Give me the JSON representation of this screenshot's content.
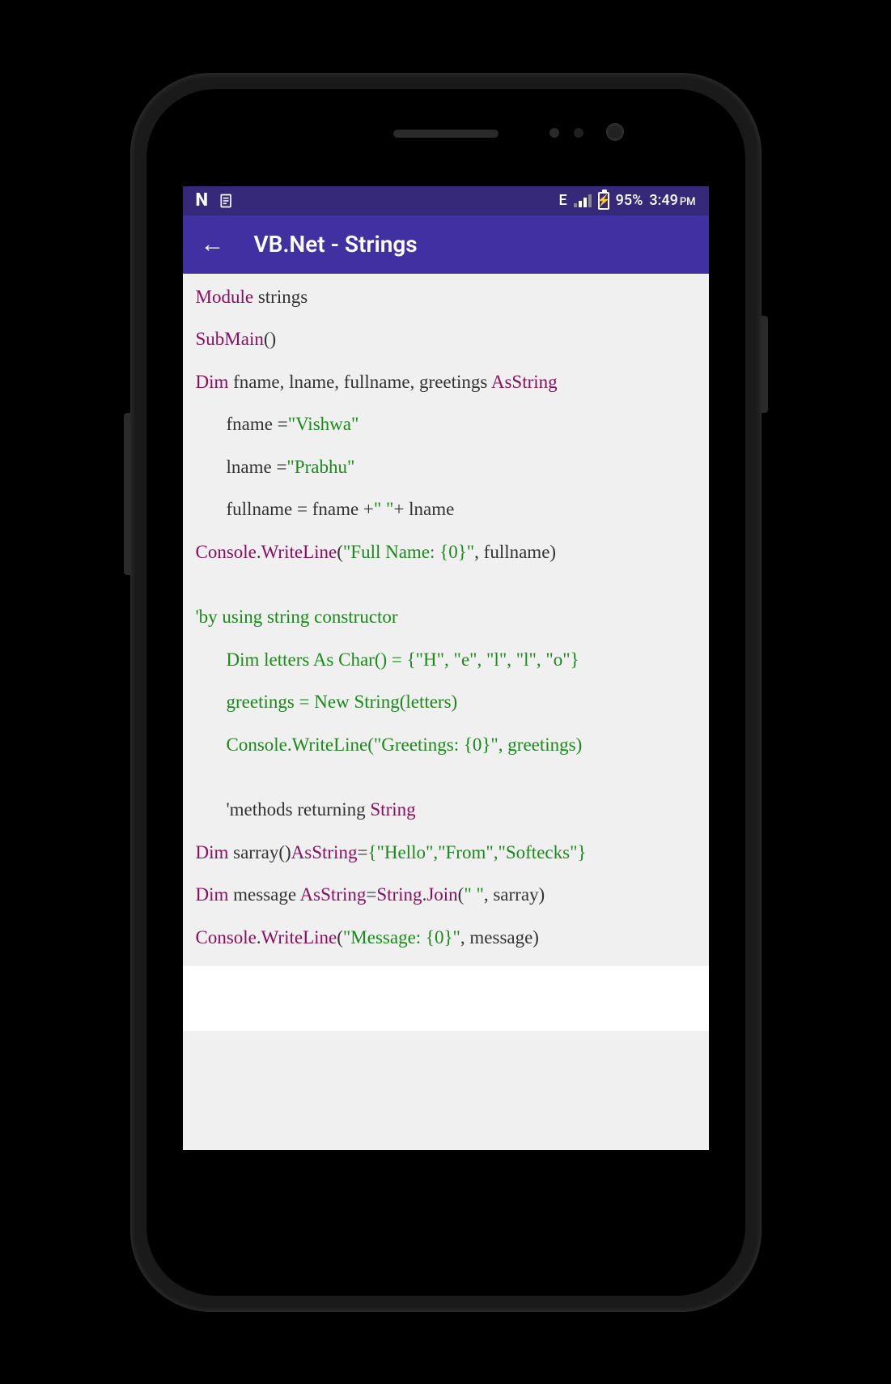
{
  "status": {
    "n_label": "N",
    "network_label": "E",
    "battery_pct": "95%",
    "time": "3:49",
    "ampm": "PM"
  },
  "appbar": {
    "title": "VB.Net - Strings"
  },
  "code": {
    "l1_kw": "Module",
    "l1_txt": " strings",
    "l2_kw": "SubMain",
    "l2_txt": "()",
    "l3_kw1": "Dim",
    "l3_txt": " fname, lname, fullname, greetings ",
    "l3_kw2": "AsString",
    "l4_txt": "fname =",
    "l4_str": "\"Vishwa\"",
    "l5_txt": "lname =",
    "l5_str": "\"Prabhu\"",
    "l6_txt1": "fullname = fname +",
    "l6_str": "\" \"",
    "l6_txt2": "+ lname",
    "l7_kw": "Console",
    "l7_txt1": ".",
    "l7_kw2": "WriteLine",
    "l7_txt2": "(",
    "l7_str": "\"Full Name: {0}\"",
    "l7_txt3": ", fullname)",
    "l8_grn": "'by using string constructor",
    "l9_grn": "Dim letters As Char() = {\"H\", \"e\", \"l\", \"l\", \"o\"}",
    "l10_grn": "greetings = New String(letters)",
    "l11_grn": "Console.WriteLine(\"Greetings: {0}\", greetings)",
    "l12_txt": "'methods returning ",
    "l12_kw": "String",
    "l13_kw1": "Dim",
    "l13_txt1": " sarray()",
    "l13_kw2": "AsString",
    "l13_txt2": "=",
    "l13_str": "{\"Hello\",\"From\",\"Softecks\"}",
    "l14_kw1": "Dim",
    "l14_txt1": " message ",
    "l14_kw2": "AsString",
    "l14_txt2": "=",
    "l14_kw3": "String",
    "l14_txt3": ".",
    "l14_kw4": "Join",
    "l14_txt4": "(",
    "l14_str": "\" \"",
    "l14_txt5": ", sarray)",
    "l15_kw": "Console",
    "l15_txt1": ".",
    "l15_kw2": "WriteLine",
    "l15_txt2": "(",
    "l15_str": "\"Message: {0}\"",
    "l15_txt3": ", message)"
  }
}
